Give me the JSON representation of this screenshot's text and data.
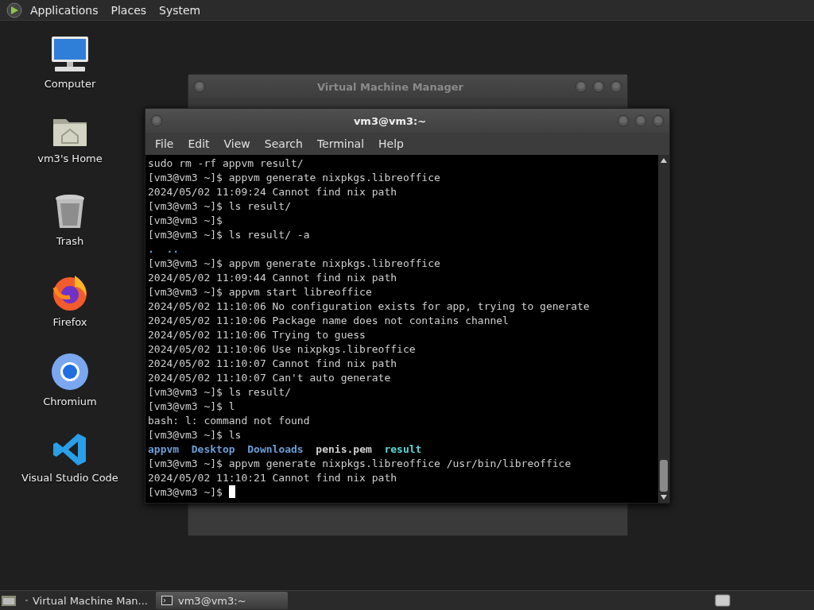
{
  "top_panel": {
    "menus": [
      "Applications",
      "Places",
      "System"
    ]
  },
  "desktop_icons": [
    {
      "kind": "computer",
      "label": "Computer"
    },
    {
      "kind": "home",
      "label": "vm3's Home"
    },
    {
      "kind": "trash",
      "label": "Trash"
    },
    {
      "kind": "firefox",
      "label": "Firefox"
    },
    {
      "kind": "chromium",
      "label": "Chromium"
    },
    {
      "kind": "vscode",
      "label": "Visual Studio Code"
    }
  ],
  "background_window": {
    "title": "Virtual Machine Manager"
  },
  "terminal": {
    "title": "vm3@vm3:~",
    "menu": [
      "File",
      "Edit",
      "View",
      "Search",
      "Terminal",
      "Help"
    ],
    "lines": [
      {
        "kind": "text",
        "text": "sudo rm -rf appvm result/"
      },
      {
        "kind": "text",
        "text": "[vm3@vm3 ~]$ appvm generate nixpkgs.libreoffice"
      },
      {
        "kind": "text",
        "text": "2024/05/02 11:09:24 Cannot find nix path"
      },
      {
        "kind": "text",
        "text": "[vm3@vm3 ~]$ ls result/"
      },
      {
        "kind": "text",
        "text": "[vm3@vm3 ~]$"
      },
      {
        "kind": "text",
        "text": "[vm3@vm3 ~]$ ls result/ -a"
      },
      {
        "kind": "listing",
        "entries": [
          {
            "name": ".",
            "color": "#6a9fd8"
          },
          {
            "name": "..",
            "color": "#6a9fd8"
          }
        ]
      },
      {
        "kind": "text",
        "text": "[vm3@vm3 ~]$ appvm generate nixpkgs.libreoffice"
      },
      {
        "kind": "text",
        "text": "2024/05/02 11:09:44 Cannot find nix path"
      },
      {
        "kind": "text",
        "text": "[vm3@vm3 ~]$ appvm start libreoffice"
      },
      {
        "kind": "text",
        "text": "2024/05/02 11:10:06 No configuration exists for app, trying to generate"
      },
      {
        "kind": "text",
        "text": "2024/05/02 11:10:06 Package name does not contains channel"
      },
      {
        "kind": "text",
        "text": "2024/05/02 11:10:06 Trying to guess"
      },
      {
        "kind": "text",
        "text": "2024/05/02 11:10:06 Use nixpkgs.libreoffice"
      },
      {
        "kind": "text",
        "text": "2024/05/02 11:10:07 Cannot find nix path"
      },
      {
        "kind": "text",
        "text": "2024/05/02 11:10:07 Can't auto generate"
      },
      {
        "kind": "text",
        "text": "[vm3@vm3 ~]$ ls result/"
      },
      {
        "kind": "text",
        "text": "[vm3@vm3 ~]$ l"
      },
      {
        "kind": "text",
        "text": "bash: l: command not found"
      },
      {
        "kind": "text",
        "text": "[vm3@vm3 ~]$ ls"
      },
      {
        "kind": "listing",
        "entries": [
          {
            "name": "appvm",
            "color": "#6a9fd8"
          },
          {
            "name": "Desktop",
            "color": "#6a9fd8"
          },
          {
            "name": "Downloads",
            "color": "#6a9fd8"
          },
          {
            "name": "penis.pem",
            "color": "#d0d0d0"
          },
          {
            "name": "result",
            "color": "#5fd7d7"
          }
        ]
      },
      {
        "kind": "text",
        "text": "[vm3@vm3 ~]$ appvm generate nixpkgs.libreoffice /usr/bin/libreoffice"
      },
      {
        "kind": "text",
        "text": "2024/05/02 11:10:21 Cannot find nix path"
      },
      {
        "kind": "prompt",
        "text": "[vm3@vm3 ~]$"
      }
    ]
  },
  "taskbar": {
    "tasks": [
      {
        "kind": "vmm",
        "label": "Virtual Machine Man...",
        "selected": false
      },
      {
        "kind": "terminal",
        "label": "vm3@vm3:~",
        "selected": true
      }
    ]
  }
}
